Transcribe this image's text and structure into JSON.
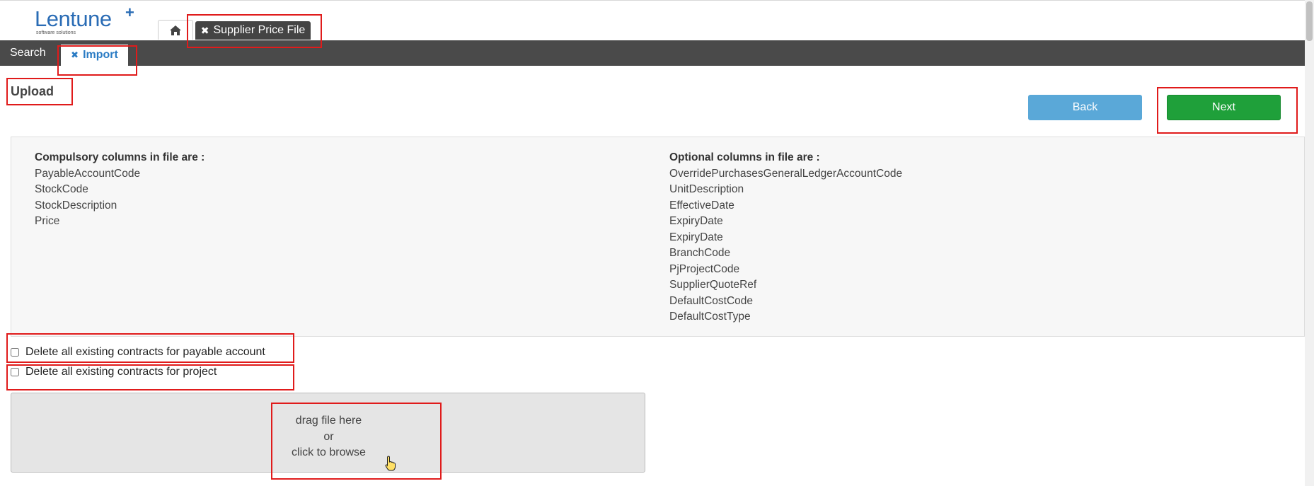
{
  "header": {
    "logo_text": "Lentune",
    "logo_plus": "+",
    "logo_tagline": "software solutions",
    "home_icon": "home-icon",
    "doc_tab": {
      "close_glyph": "✖",
      "label": "Supplier Price File"
    }
  },
  "subnav": {
    "search_label": "Search",
    "import_tab": {
      "close_glyph": "✖",
      "label": "Import"
    }
  },
  "page": {
    "title": "Upload",
    "back_label": "Back",
    "next_label": "Next"
  },
  "columns_info": {
    "compulsory_heading": "Compulsory columns in file are :",
    "compulsory": [
      "PayableAccountCode",
      "StockCode",
      "StockDescription",
      "Price"
    ],
    "optional_heading": "Optional columns in file are :",
    "optional": [
      "OverridePurchasesGeneralLedgerAccountCode",
      "UnitDescription",
      "EffectiveDate",
      "ExpiryDate",
      "ExpiryDate",
      "BranchCode",
      "PjProjectCode",
      "SupplierQuoteRef",
      "DefaultCostCode",
      "DefaultCostType"
    ]
  },
  "options": {
    "delete_payable_label": "Delete all existing contracts for payable account",
    "delete_payable_checked": false,
    "delete_project_label": "Delete all existing contracts for project",
    "delete_project_checked": false
  },
  "dropzone": {
    "line1": "drag file here",
    "line2": "or",
    "line3": "click to browse"
  },
  "colors": {
    "nav_bg": "#4a4a4a",
    "back_button": "#5aa8d8",
    "next_button": "#1fa03a",
    "accent": "#2a7bc4",
    "annotation_red": "#e01b1b"
  }
}
